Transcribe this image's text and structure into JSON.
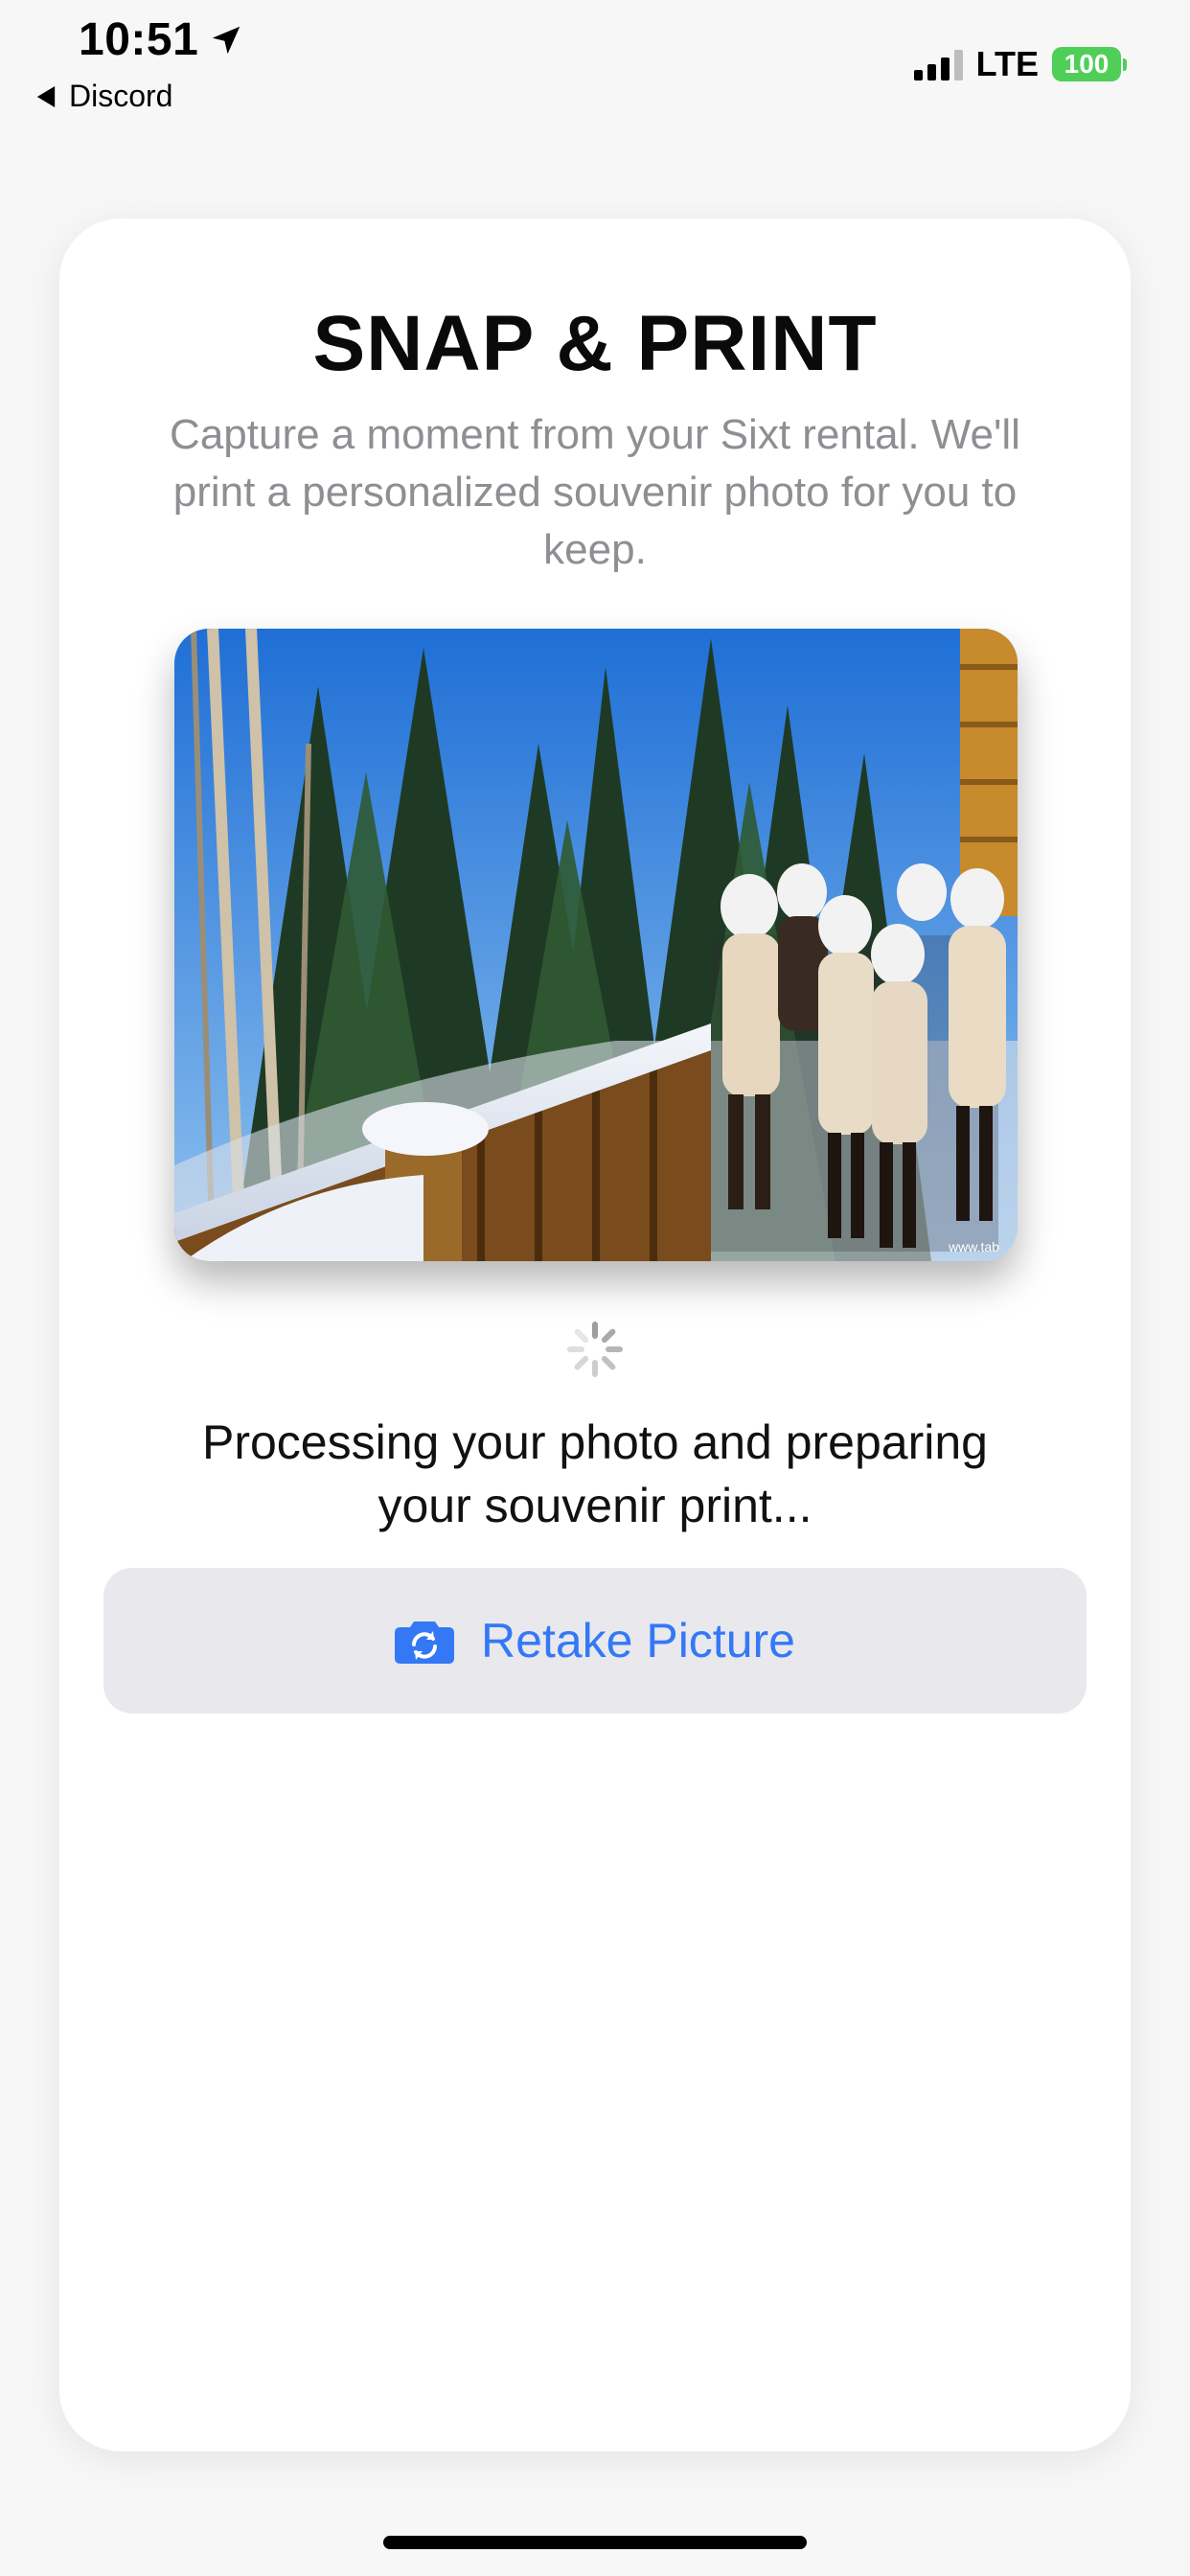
{
  "status_bar": {
    "time": "10:51",
    "back_app": "Discord",
    "network": "LTE",
    "battery": "100",
    "location_icon": "location-arrow-icon",
    "back_icon": "back-triangle-icon"
  },
  "card": {
    "title": "SNAP & PRINT",
    "subtitle": "Capture a moment from your Sixt rental. We'll print a personalized souvenir photo for you to keep.",
    "photo_watermark": "www.tab",
    "processing_text": "Processing your photo and preparing your souvenir print...",
    "retake_button": {
      "label": "Retake Picture",
      "icon": "camera-rotate-icon"
    }
  },
  "colors": {
    "accent": "#3478f6",
    "battery": "#4fcf57",
    "subtitle_gray": "#8e8e93",
    "button_bg": "#e8e8ed"
  }
}
